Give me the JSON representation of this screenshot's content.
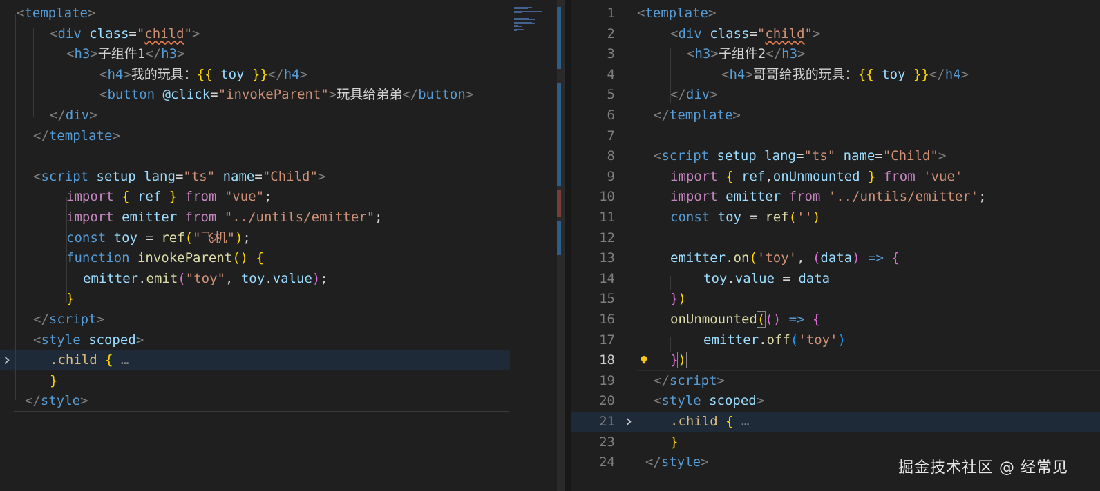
{
  "left_editor": {
    "lines": [
      [
        [
          "c-tag",
          "<"
        ],
        [
          "c-tn",
          "template"
        ],
        [
          "c-tag",
          ">"
        ]
      ],
      [
        [
          "c-tag",
          "<"
        ],
        [
          "c-tn",
          "div "
        ],
        [
          "c-attr",
          "class"
        ],
        [
          "c-eq",
          "="
        ],
        [
          "c-str",
          "\""
        ],
        [
          "c-str squig",
          "child"
        ],
        [
          "c-str",
          "\""
        ],
        [
          "c-tag",
          ">"
        ]
      ],
      [
        [
          "c-tag",
          "<"
        ],
        [
          "c-tn",
          "h3"
        ],
        [
          "c-tag",
          ">"
        ],
        [
          "c-txt",
          "子组件1"
        ],
        [
          "c-tag",
          "</"
        ],
        [
          "c-tn",
          "h3"
        ],
        [
          "c-tag",
          ">"
        ]
      ],
      [
        [
          "c-tag",
          "<"
        ],
        [
          "c-tn",
          "h4"
        ],
        [
          "c-tag",
          ">"
        ],
        [
          "c-txt",
          "我的玩具："
        ],
        [
          "c-b1",
          "{{"
        ],
        [
          "c-var",
          " toy "
        ],
        [
          "c-b1",
          "}}"
        ],
        [
          "c-tag",
          "</"
        ],
        [
          "c-tn",
          "h4"
        ],
        [
          "c-tag",
          ">"
        ]
      ],
      [
        [
          "c-tag",
          "<"
        ],
        [
          "c-tn",
          "button "
        ],
        [
          "c-attr",
          "@click"
        ],
        [
          "c-eq",
          "="
        ],
        [
          "c-str",
          "\"invokeParent\""
        ],
        [
          "c-tag",
          ">"
        ],
        [
          "c-txt",
          "玩具给弟弟"
        ],
        [
          "c-tag",
          "</"
        ],
        [
          "c-tn",
          "button"
        ],
        [
          "c-tag",
          ">"
        ]
      ],
      [
        [
          "c-tag",
          "</"
        ],
        [
          "c-tn",
          "div"
        ],
        [
          "c-tag",
          ">"
        ]
      ],
      [
        [
          "c-tag",
          "</"
        ],
        [
          "c-tn",
          "template"
        ],
        [
          "c-tag",
          ">"
        ]
      ],
      [],
      [
        [
          "c-tag",
          "<"
        ],
        [
          "c-tn",
          "script "
        ],
        [
          "c-attr",
          "setup "
        ],
        [
          "c-attr",
          "lang"
        ],
        [
          "c-eq",
          "="
        ],
        [
          "c-str",
          "\"ts\" "
        ],
        [
          "c-attr",
          "name"
        ],
        [
          "c-eq",
          "="
        ],
        [
          "c-str",
          "\"Child\""
        ],
        [
          "c-tag",
          ">"
        ]
      ],
      [
        [
          "c-ctl",
          "import "
        ],
        [
          "c-b1",
          "{ "
        ],
        [
          "c-var",
          "ref "
        ],
        [
          "c-b1",
          "} "
        ],
        [
          "c-ctl",
          "from "
        ],
        [
          "c-str",
          "\"vue\""
        ],
        [
          "c-pun",
          ";"
        ]
      ],
      [
        [
          "c-ctl",
          "import "
        ],
        [
          "c-var",
          "emitter "
        ],
        [
          "c-ctl",
          "from "
        ],
        [
          "c-str",
          "\"../untils/emitter\""
        ],
        [
          "c-pun",
          ";"
        ]
      ],
      [
        [
          "c-kw",
          "const "
        ],
        [
          "c-var",
          "toy "
        ],
        [
          "c-pun",
          "= "
        ],
        [
          "c-fn",
          "ref"
        ],
        [
          "c-b1",
          "("
        ],
        [
          "c-str",
          "\"飞机\""
        ],
        [
          "c-b1",
          ")"
        ],
        [
          "c-pun",
          ";"
        ]
      ],
      [
        [
          "c-kw",
          "function "
        ],
        [
          "c-fn",
          "invokeParent"
        ],
        [
          "c-b1",
          "() {"
        ]
      ],
      [
        [
          "c-var",
          "emitter"
        ],
        [
          "c-pun",
          "."
        ],
        [
          "c-fn",
          "emit"
        ],
        [
          "c-b2",
          "("
        ],
        [
          "c-str",
          "\"toy\""
        ],
        [
          "c-pun",
          ", "
        ],
        [
          "c-var",
          "toy"
        ],
        [
          "c-pun",
          "."
        ],
        [
          "c-var",
          "value"
        ],
        [
          "c-b2",
          ")"
        ],
        [
          "c-pun",
          ";"
        ]
      ],
      [
        [
          "c-b1",
          "}"
        ]
      ],
      [
        [
          "c-tag",
          "</"
        ],
        [
          "c-tn",
          "script"
        ],
        [
          "c-tag",
          ">"
        ]
      ],
      [
        [
          "c-tag",
          "<"
        ],
        [
          "c-tn",
          "style "
        ],
        [
          "c-attr",
          "scoped"
        ],
        [
          "c-tag",
          ">"
        ]
      ],
      [
        [
          "c-cls",
          ".child "
        ],
        [
          "c-b1",
          "{"
        ],
        [
          "c-cmt",
          " …"
        ]
      ],
      [
        [
          "c-b1",
          "}"
        ]
      ],
      [
        [
          "c-tag",
          "</"
        ],
        [
          "c-tn",
          "style"
        ],
        [
          "c-tag",
          ">"
        ]
      ]
    ]
  },
  "right_editor": {
    "line_numbers": [
      "1",
      "2",
      "3",
      "4",
      "5",
      "6",
      "7",
      "8",
      "9",
      "10",
      "11",
      "12",
      "13",
      "14",
      "15",
      "16",
      "17",
      "18",
      "19",
      "20",
      "21",
      "23",
      "24"
    ],
    "current_line": "18",
    "lines": [
      [
        [
          "c-tag",
          "<"
        ],
        [
          "c-tn",
          "template"
        ],
        [
          "c-tag",
          ">"
        ]
      ],
      [
        [
          "c-tag",
          "<"
        ],
        [
          "c-tn",
          "div "
        ],
        [
          "c-attr",
          "class"
        ],
        [
          "c-eq",
          "="
        ],
        [
          "c-str",
          "\""
        ],
        [
          "c-str squig",
          "child"
        ],
        [
          "c-str",
          "\""
        ],
        [
          "c-tag",
          ">"
        ]
      ],
      [
        [
          "c-tag",
          "<"
        ],
        [
          "c-tn",
          "h3"
        ],
        [
          "c-tag",
          ">"
        ],
        [
          "c-txt",
          "子组件2"
        ],
        [
          "c-tag",
          "</"
        ],
        [
          "c-tn",
          "h3"
        ],
        [
          "c-tag",
          ">"
        ]
      ],
      [
        [
          "c-tag",
          "<"
        ],
        [
          "c-tn",
          "h4"
        ],
        [
          "c-tag",
          ">"
        ],
        [
          "c-txt",
          "哥哥给我的玩具："
        ],
        [
          "c-b1",
          "{{"
        ],
        [
          "c-var",
          " toy "
        ],
        [
          "c-b1",
          "}}"
        ],
        [
          "c-tag",
          "</"
        ],
        [
          "c-tn",
          "h4"
        ],
        [
          "c-tag",
          ">"
        ]
      ],
      [
        [
          "c-tag",
          "</"
        ],
        [
          "c-tn",
          "div"
        ],
        [
          "c-tag",
          ">"
        ]
      ],
      [
        [
          "c-tag",
          "</"
        ],
        [
          "c-tn",
          "template"
        ],
        [
          "c-tag",
          ">"
        ]
      ],
      [],
      [
        [
          "c-tag",
          "<"
        ],
        [
          "c-tn",
          "script "
        ],
        [
          "c-attr",
          "setup "
        ],
        [
          "c-attr",
          "lang"
        ],
        [
          "c-eq",
          "="
        ],
        [
          "c-str",
          "\"ts\" "
        ],
        [
          "c-attr",
          "name"
        ],
        [
          "c-eq",
          "="
        ],
        [
          "c-str",
          "\"Child\""
        ],
        [
          "c-tag",
          ">"
        ]
      ],
      [
        [
          "c-ctl",
          "import "
        ],
        [
          "c-b1",
          "{ "
        ],
        [
          "c-var",
          "ref"
        ],
        [
          "c-pun",
          ","
        ],
        [
          "c-var",
          "onUnmounted "
        ],
        [
          "c-b1",
          "} "
        ],
        [
          "c-ctl",
          "from "
        ],
        [
          "c-str",
          "'vue'"
        ]
      ],
      [
        [
          "c-ctl",
          "import "
        ],
        [
          "c-var",
          "emitter "
        ],
        [
          "c-ctl",
          "from "
        ],
        [
          "c-str",
          "'../untils/emitter'"
        ],
        [
          "c-pun",
          ";"
        ]
      ],
      [
        [
          "c-kw",
          "const "
        ],
        [
          "c-var",
          "toy "
        ],
        [
          "c-pun",
          "= "
        ],
        [
          "c-fn",
          "ref"
        ],
        [
          "c-b1",
          "("
        ],
        [
          "c-str",
          "''"
        ],
        [
          "c-b1",
          ")"
        ]
      ],
      [],
      [
        [
          "c-var",
          "emitter"
        ],
        [
          "c-pun",
          "."
        ],
        [
          "c-fn",
          "on"
        ],
        [
          "c-b1",
          "("
        ],
        [
          "c-str",
          "'toy'"
        ],
        [
          "c-pun",
          ", "
        ],
        [
          "c-b2",
          "("
        ],
        [
          "c-var",
          "data"
        ],
        [
          "c-b2",
          ")"
        ],
        [
          "c-kw",
          " => "
        ],
        [
          "c-b2",
          "{"
        ]
      ],
      [
        [
          "c-var",
          "toy"
        ],
        [
          "c-pun",
          "."
        ],
        [
          "c-var",
          "value "
        ],
        [
          "c-pun",
          "= "
        ],
        [
          "c-var",
          "data"
        ]
      ],
      [
        [
          "c-b2",
          "}"
        ],
        [
          "c-b1",
          ")"
        ]
      ],
      [
        [
          "c-fn",
          "onUnmounted"
        ],
        [
          "c-b1 bracket-box",
          "("
        ],
        [
          "c-b2",
          "()"
        ],
        [
          "c-kw",
          " => "
        ],
        [
          "c-b2",
          "{"
        ]
      ],
      [
        [
          "c-var",
          "emitter"
        ],
        [
          "c-pun",
          "."
        ],
        [
          "c-fn",
          "off"
        ],
        [
          "c-b3",
          "("
        ],
        [
          "c-str",
          "'toy'"
        ],
        [
          "c-b3",
          ")"
        ]
      ],
      [
        [
          "c-b2",
          "}"
        ],
        [
          "c-b1 bracket-box",
          ")"
        ]
      ],
      [
        [
          "c-tag",
          "</"
        ],
        [
          "c-tn",
          "script"
        ],
        [
          "c-tag",
          ">"
        ]
      ],
      [
        [
          "c-tag",
          "<"
        ],
        [
          "c-tn",
          "style "
        ],
        [
          "c-attr",
          "scoped"
        ],
        [
          "c-tag",
          ">"
        ]
      ],
      [
        [
          "c-cls",
          ".child "
        ],
        [
          "c-b1",
          "{"
        ],
        [
          "c-cmt",
          " …"
        ]
      ],
      [
        [
          "c-b1",
          "}"
        ]
      ],
      [
        [
          "c-tag",
          "</"
        ],
        [
          "c-tn",
          "style"
        ],
        [
          "c-tag",
          ">"
        ]
      ]
    ]
  },
  "colors": {
    "background": "#1f1f1f",
    "highlight": "#1e2a38",
    "bulb": "#f5c518"
  },
  "icons": {
    "fold": "chevron-right-icon",
    "hint": "lightbulb-icon"
  },
  "watermark": "掘金技术社区 @ 经常见"
}
